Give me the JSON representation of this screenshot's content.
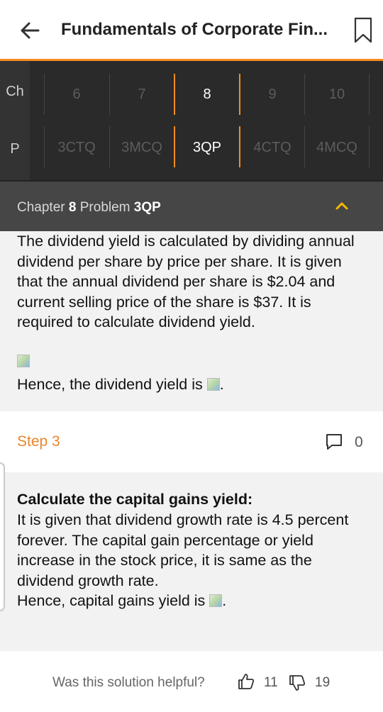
{
  "header": {
    "title": "Fundamentals of Corporate Fin..."
  },
  "nav": {
    "chapter_label": "Ch",
    "problem_label": "P",
    "chapters": [
      "6",
      "7",
      "8",
      "9",
      "10"
    ],
    "problems": [
      "3CTQ",
      "3MCQ",
      "3QP",
      "4CTQ",
      "4MCQ"
    ],
    "active_chapter": "8",
    "active_problem": "3QP"
  },
  "section_header": {
    "chapter_word": "Chapter",
    "chapter_num": "8",
    "problem_word": "Problem",
    "problem_id": "3QP"
  },
  "step2": {
    "paragraph": "The dividend yield is calculated by dividing annual dividend per share by price per share. It is given that the annual dividend per share is $2.04 and current selling price of the share is $37. It is required to calculate dividend yield.",
    "conclusion": "Hence, the dividend yield is"
  },
  "step3": {
    "title": "Step 3",
    "comment_count": "0",
    "heading": "Calculate the capital gains yield:",
    "paragraph": "It is given that dividend growth rate is 4.5 percent forever. The capital gain percentage or yield increase in the stock price, it is same as the dividend growth rate.",
    "conclusion": "Hence, capital gains yield is"
  },
  "footer": {
    "question": "Was this solution helpful?",
    "likes": "11",
    "dislikes": "19"
  },
  "colors": {
    "accent": "#f68b1f",
    "nav_bg": "#333333",
    "header_band": "#464646"
  }
}
